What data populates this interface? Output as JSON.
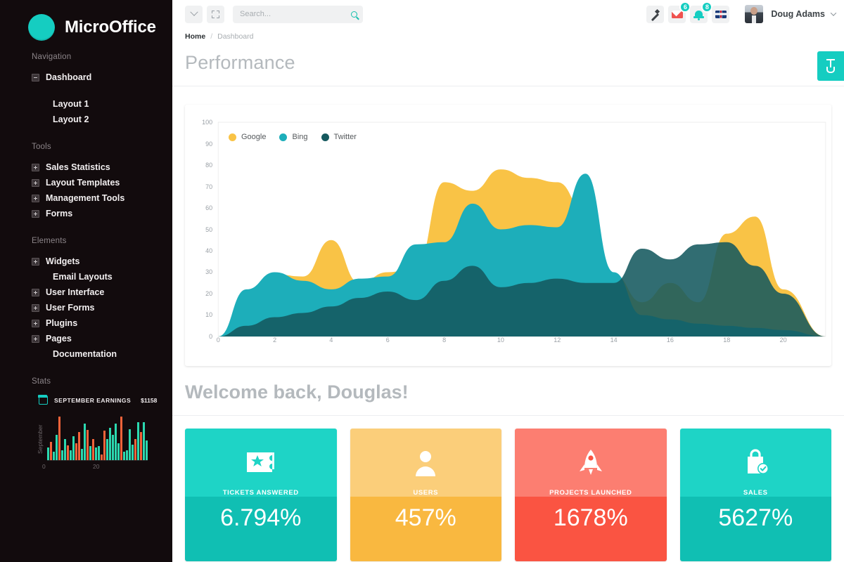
{
  "brand": {
    "name": "MicroOffice",
    "logo_icon": "circle-logo",
    "logo_color": "#15CDC1"
  },
  "sidebar": {
    "sections": [
      {
        "title": "Navigation",
        "items": [
          {
            "label": "Dashboard",
            "icon": "minus-box-icon",
            "has_icon": true,
            "expanded": true
          },
          {
            "label": "Layout 1",
            "icon": "none",
            "has_icon": false,
            "sub": true
          },
          {
            "label": "Layout 2",
            "icon": "none",
            "has_icon": false,
            "sub": true
          }
        ]
      },
      {
        "title": "Tools",
        "items": [
          {
            "label": "Sales Statistics",
            "icon": "plus-box-icon",
            "has_icon": true
          },
          {
            "label": "Layout Templates",
            "icon": "plus-box-icon",
            "has_icon": true
          },
          {
            "label": "Management Tools",
            "icon": "plus-box-icon",
            "has_icon": true
          },
          {
            "label": "Forms",
            "icon": "plus-box-icon",
            "has_icon": true
          }
        ]
      },
      {
        "title": "Elements",
        "items": [
          {
            "label": "Widgets",
            "icon": "plus-box-icon",
            "has_icon": true
          },
          {
            "label": "Email Layouts",
            "icon": "none",
            "has_icon": false
          },
          {
            "label": "User Interface",
            "icon": "plus-box-icon",
            "has_icon": true
          },
          {
            "label": "User Forms",
            "icon": "plus-box-icon",
            "has_icon": true
          },
          {
            "label": "Plugins",
            "icon": "plus-box-icon",
            "has_icon": true
          },
          {
            "label": "Pages",
            "icon": "plus-box-icon",
            "has_icon": true
          },
          {
            "label": "Documentation",
            "icon": "none",
            "has_icon": false
          }
        ]
      }
    ],
    "stats": {
      "title": "Stats",
      "earnings_label": "SEPTEMBER EARNINGS",
      "earnings_value": "$1158",
      "calendar_icon": "calendar-icon",
      "sparkline": {
        "ylabel": "September",
        "xticks": [
          "0",
          "20"
        ],
        "bar_color_a": "#2BD9B0",
        "bar_color_b": "#F4633A",
        "bars": [
          {
            "h": 18,
            "c": "a"
          },
          {
            "h": 26,
            "c": "b"
          },
          {
            "h": 12,
            "c": "a"
          },
          {
            "h": 36,
            "c": "a"
          },
          {
            "h": 62,
            "c": "b"
          },
          {
            "h": 14,
            "c": "a"
          },
          {
            "h": 30,
            "c": "a"
          },
          {
            "h": 21,
            "c": "b"
          },
          {
            "h": 14,
            "c": "a"
          },
          {
            "h": 34,
            "c": "a"
          },
          {
            "h": 24,
            "c": "b"
          },
          {
            "h": 40,
            "c": "b"
          },
          {
            "h": 16,
            "c": "a"
          },
          {
            "h": 52,
            "c": "a"
          },
          {
            "h": 43,
            "c": "b"
          },
          {
            "h": 20,
            "c": "a"
          },
          {
            "h": 30,
            "c": "b"
          },
          {
            "h": 18,
            "c": "a"
          },
          {
            "h": 20,
            "c": "a"
          },
          {
            "h": 8,
            "c": "b"
          },
          {
            "h": 42,
            "c": "b"
          },
          {
            "h": 30,
            "c": "a"
          },
          {
            "h": 46,
            "c": "a"
          },
          {
            "h": 36,
            "c": "a"
          },
          {
            "h": 52,
            "c": "a"
          },
          {
            "h": 24,
            "c": "a"
          },
          {
            "h": 62,
            "c": "b"
          },
          {
            "h": 12,
            "c": "a"
          },
          {
            "h": 14,
            "c": "a"
          },
          {
            "h": 44,
            "c": "a"
          },
          {
            "h": 22,
            "c": "a"
          },
          {
            "h": 30,
            "c": "b"
          },
          {
            "h": 54,
            "c": "a"
          },
          {
            "h": 40,
            "c": "b"
          },
          {
            "h": 54,
            "c": "a"
          },
          {
            "h": 28,
            "c": "a"
          }
        ]
      }
    }
  },
  "topbar": {
    "collapse_icon": "chevron-down-icon",
    "fullscreen_icon": "expand-icon",
    "search": {
      "placeholder": "Search...",
      "value": "",
      "icon": "search-icon"
    },
    "icons": [
      {
        "name": "magic-wand-icon",
        "badge": ""
      },
      {
        "name": "envelope-icon",
        "badge": "6"
      },
      {
        "name": "bell-icon",
        "badge": "8"
      },
      {
        "name": "flag-uk-icon",
        "badge": ""
      }
    ],
    "user": {
      "name": "Doug Adams",
      "avatar_icon": "avatar",
      "caret_icon": "chevron-down-icon"
    }
  },
  "breadcrumb": {
    "home": "Home",
    "separator": "/",
    "current": "Dashboard"
  },
  "page": {
    "title": "Performance",
    "welcome": "Welcome back, Douglas!",
    "right_tab_icon": "shovel-icon"
  },
  "chart_data": {
    "type": "area",
    "title": "Performance",
    "xlabel": "",
    "ylabel": "",
    "xlim": [
      0,
      21.5
    ],
    "ylim": [
      0,
      100
    ],
    "xticks": [
      0,
      2,
      4,
      6,
      8,
      10,
      12,
      14,
      16,
      18,
      20
    ],
    "yticks": [
      0,
      10,
      20,
      30,
      40,
      50,
      60,
      70,
      80,
      90,
      100
    ],
    "grid": false,
    "legend_position": "top-left",
    "stacked": false,
    "series": [
      {
        "name": "Google",
        "color": "#F9C346",
        "x": [
          0,
          1,
          2,
          3,
          4,
          5,
          6,
          7,
          8,
          9,
          10,
          11,
          12,
          13,
          14,
          15,
          16,
          17,
          18,
          19,
          20,
          21.5
        ],
        "values": [
          0,
          18,
          29,
          28,
          45,
          25,
          30,
          32,
          72,
          68,
          78,
          74,
          72,
          58,
          29,
          16,
          25,
          16,
          48,
          56,
          22,
          0
        ]
      },
      {
        "name": "Bing",
        "color": "#1DAEBA",
        "x": [
          0,
          1,
          2,
          3,
          4,
          5,
          6,
          7,
          8,
          9,
          10,
          11,
          12,
          13,
          14,
          15,
          16,
          17,
          18,
          19,
          20,
          21.5
        ],
        "values": [
          0,
          22,
          30,
          26,
          22,
          27,
          28,
          43,
          44,
          62,
          50,
          52,
          51,
          76,
          30,
          10,
          8,
          6,
          5,
          4,
          3,
          0
        ]
      },
      {
        "name": "Twitter",
        "color": "#15595E",
        "x": [
          0,
          1,
          2,
          3,
          4,
          5,
          6,
          7,
          8,
          9,
          10,
          11,
          12,
          13,
          14,
          15,
          16,
          17,
          18,
          19,
          20,
          21.5
        ],
        "values": [
          0,
          5,
          9,
          11,
          14,
          18,
          21,
          17,
          26,
          33,
          23,
          25,
          27,
          25,
          25,
          41,
          36,
          43,
          44,
          33,
          20,
          0
        ]
      }
    ]
  },
  "cards": [
    {
      "label": "TICKETS ANSWERED",
      "value": "6.794%",
      "icon": "ticket-star-icon",
      "color_top": "#1ED4C6",
      "color_bottom": "#10BFB3"
    },
    {
      "label": "USERS",
      "value": "457%",
      "icon": "user-icon",
      "color_top": "#FBCE7A",
      "color_bottom": "#F9B840"
    },
    {
      "label": "PROJECTS LAUNCHED",
      "value": "1678%",
      "icon": "rocket-icon",
      "color_top": "#FC7E71",
      "color_bottom": "#FA5442"
    },
    {
      "label": "SALES",
      "value": "5627%",
      "icon": "shopping-bag-check-icon",
      "color_top": "#1ED4C6",
      "color_bottom": "#10BFB3"
    }
  ]
}
